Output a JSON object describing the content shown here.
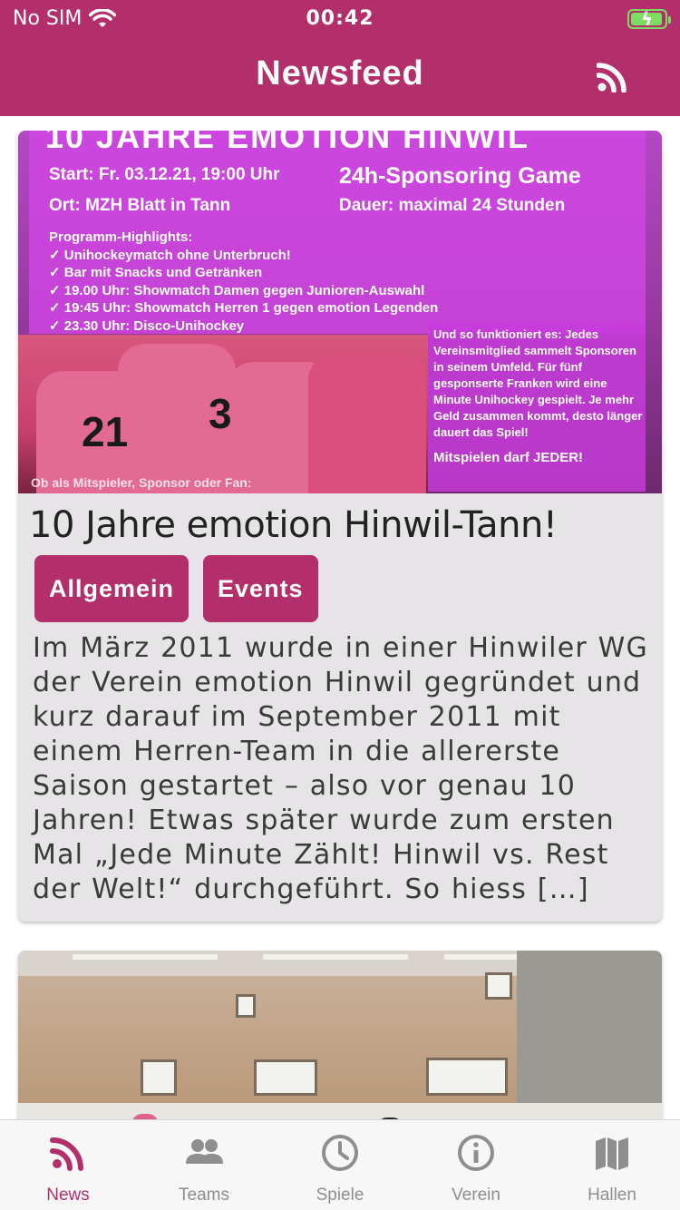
{
  "status_bar": {
    "carrier": "No SIM",
    "time": "00:42"
  },
  "header": {
    "title": "Newsfeed",
    "rss_icon": "rss-icon"
  },
  "colors": {
    "accent": "#b32f6c",
    "card_bg": "#e6e4e6",
    "tab_inactive": "#8e8e8e"
  },
  "feed": {
    "posts": [
      {
        "image": {
          "headline": "10 JAHRE EMOTION HINWIL",
          "start": "Start: Fr. 03.12.21, 19:00 Uhr",
          "location": "Ort: MZH Blatt in Tann",
          "game": "24h-Sponsoring Game",
          "duration": "Dauer: maximal 24 Stunden",
          "highlights_title": "Programm-Highlights:",
          "highlights": [
            "✓  Unihockeymatch ohne Unterbruch!",
            "✓  Bar mit Snacks und Getränken",
            "✓  19.00 Uhr: Showmatch Damen gegen Junioren-Auswahl",
            "✓  19:45 Uhr: Showmatch Herren 1 gegen emotion Legenden",
            "✓  23.30 Uhr: Disco-Unihockey"
          ],
          "explain": "Und so funktioniert es: Jedes Vereinsmitglied sammelt Sponsoren in seinem Umfeld. Für fünf gesponserte Franken wird eine Minute Unihockey gespielt. Je mehr Geld zusammen kommt, desto länger dauert das Spiel!",
          "cta": "Mitspielen darf JEDER!",
          "bottom": "Ob als Mitspieler, Sponsor oder Fan:"
        },
        "title": "10 Jahre emotion Hinwil-Tann!",
        "tags": [
          "Allgemein",
          "Events"
        ],
        "excerpt": "Im März 2011 wurde in einer Hinwiler WG der Verein emotion Hinwil gegründet und kurz darauf im September 2011 mit einem Herren-Team in die allererste Saison gestartet – also vor genau 10 Jahren! Etwas später wurde zum ersten Mal „Jede Minute Zählt! Hinwil vs. Rest der Welt!“ durchgeführt. So hiess […]"
      }
    ]
  },
  "tabbar": {
    "tabs": [
      {
        "label": "News",
        "icon": "rss-icon",
        "active": true
      },
      {
        "label": "Teams",
        "icon": "people-icon",
        "active": false
      },
      {
        "label": "Spiele",
        "icon": "clock-icon",
        "active": false
      },
      {
        "label": "Verein",
        "icon": "info-icon",
        "active": false
      },
      {
        "label": "Hallen",
        "icon": "map-icon",
        "active": false
      }
    ]
  }
}
